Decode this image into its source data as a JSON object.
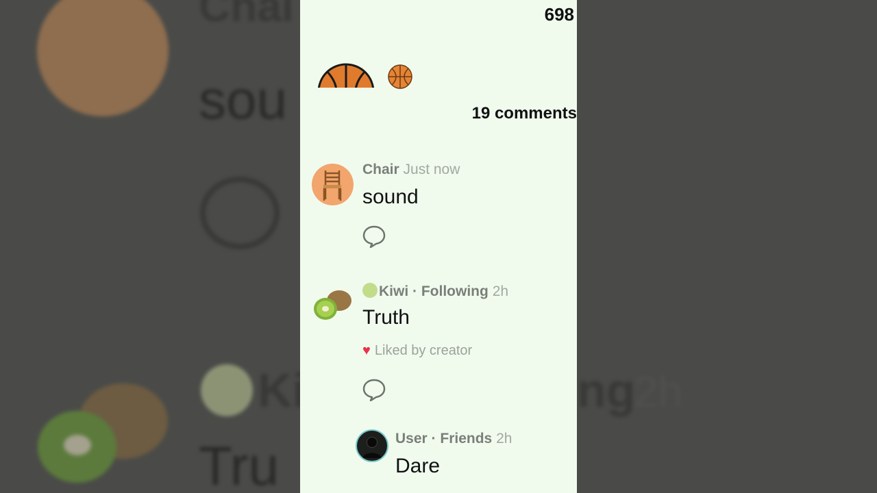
{
  "header": {
    "count": "698"
  },
  "comments_header": "19 comments",
  "comments": [
    {
      "name": "Chair",
      "separator": "",
      "relation": "",
      "time": "Just now",
      "text": "sound",
      "avatar_icon": "chair-icon"
    },
    {
      "name": "Kiwi",
      "separator": "·",
      "relation": "Following",
      "time": "2h",
      "text": "Truth",
      "liked": "Liked by creator",
      "avatar_icon": "kiwi-icon"
    },
    {
      "name": "User",
      "separator": "·",
      "relation": "Friends",
      "time": "2h",
      "text": "Dare",
      "avatar_icon": "user-silhouette-icon"
    }
  ],
  "background_echo": {
    "name1": "Chai",
    "text1": "sou",
    "name2": "Ki",
    "rel2": "ng",
    "time2": "2h",
    "text2": "Tru"
  },
  "colors": {
    "panel_bg": "#f0fbee",
    "heart": "#e8334a",
    "muted_text": "#7a7f79"
  }
}
